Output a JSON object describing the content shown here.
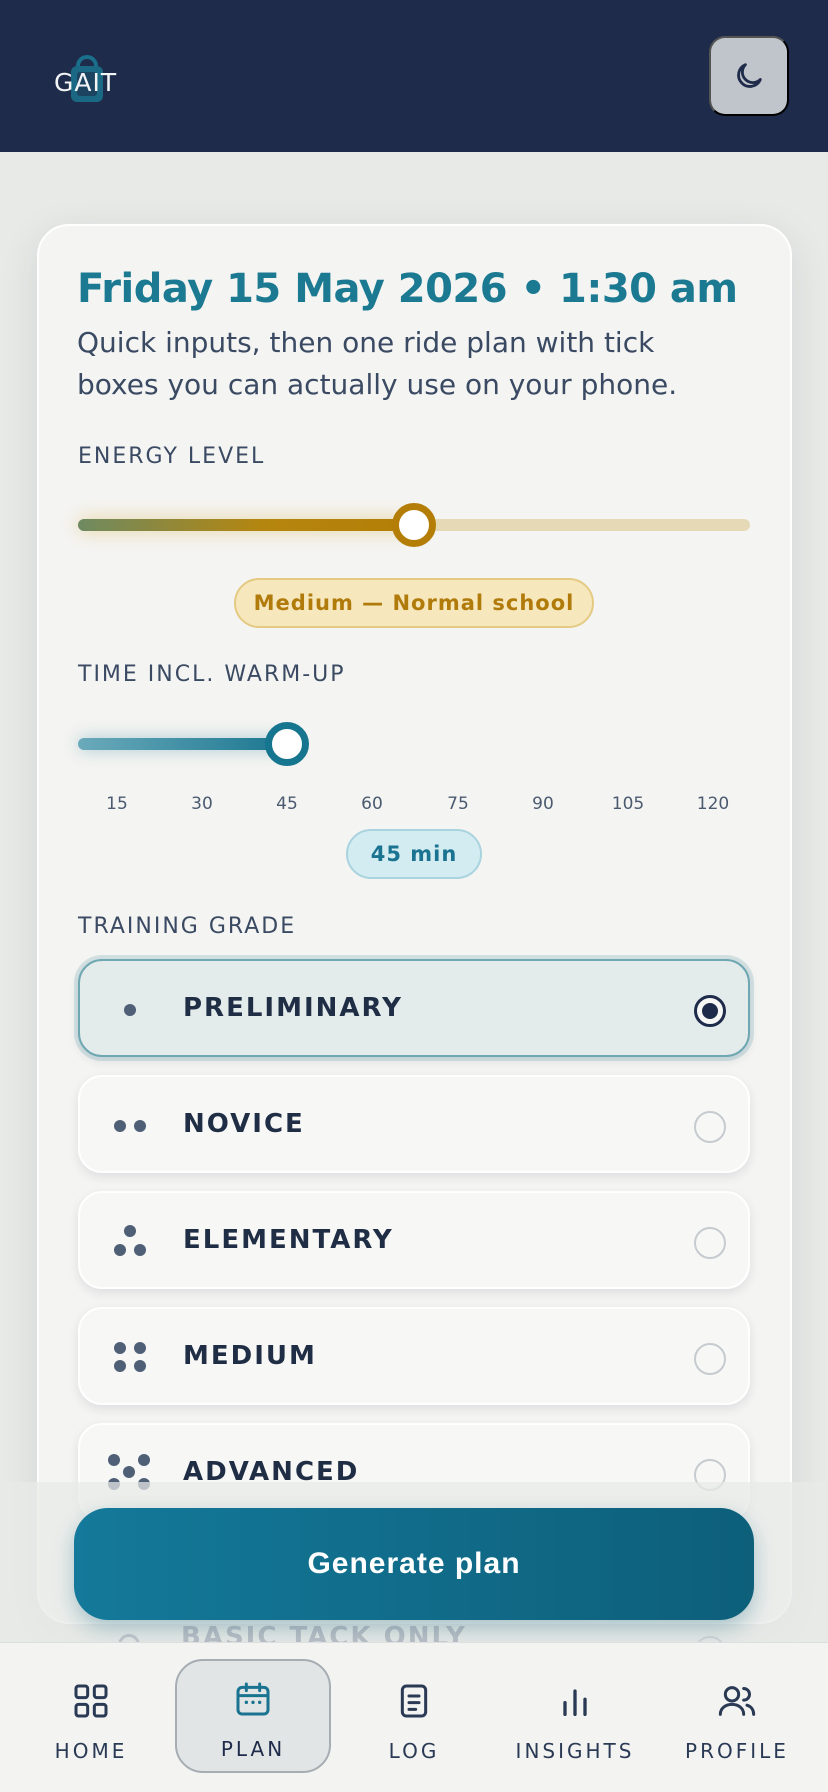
{
  "app": {
    "logo_text": "GAIT",
    "theme_toggle_icon": "moon-icon"
  },
  "header": {
    "datetime": "Friday 15 May 2026 • 1:30 am",
    "subtitle": "Quick inputs, then one ride plan with tick boxes you can actually use on your phone."
  },
  "energy": {
    "label": "ENERGY LEVEL",
    "value_fraction": 0.5,
    "badge": "Medium — Normal school",
    "colors": {
      "accent": "#b47e06",
      "track": "#e6d9b6"
    }
  },
  "time": {
    "label": "TIME INCL. WARM-UP",
    "ticks": [
      "15",
      "30",
      "45",
      "60",
      "75",
      "90",
      "105",
      "120"
    ],
    "value_minutes": 45,
    "min": 15,
    "max": 120,
    "badge": "45 min",
    "colors": {
      "accent": "#17768f"
    }
  },
  "training": {
    "label": "TRAINING GRADE",
    "grades": [
      {
        "name": "PRELIMINARY",
        "dots": 1,
        "selected": true
      },
      {
        "name": "NOVICE",
        "dots": 2,
        "selected": false
      },
      {
        "name": "ELEMENTARY",
        "dots": 3,
        "selected": false
      },
      {
        "name": "MEDIUM",
        "dots": 4,
        "selected": false
      },
      {
        "name": "ADVANCED",
        "dots": 5,
        "selected": false
      }
    ],
    "partially_hidden_option": "BASIC TACK ONLY"
  },
  "actions": {
    "generate_label": "Generate plan"
  },
  "nav": {
    "items": [
      {
        "label": "HOME",
        "icon": "grid-icon",
        "active": false
      },
      {
        "label": "PLAN",
        "icon": "calendar-icon",
        "active": true
      },
      {
        "label": "LOG",
        "icon": "document-icon",
        "active": false
      },
      {
        "label": "INSIGHTS",
        "icon": "bar-chart-icon",
        "active": false
      },
      {
        "label": "PROFILE",
        "icon": "users-icon",
        "active": false
      }
    ]
  },
  "colors": {
    "navy": "#1e2b4a",
    "teal": "#1b7a91",
    "background": "#e8eae7"
  }
}
